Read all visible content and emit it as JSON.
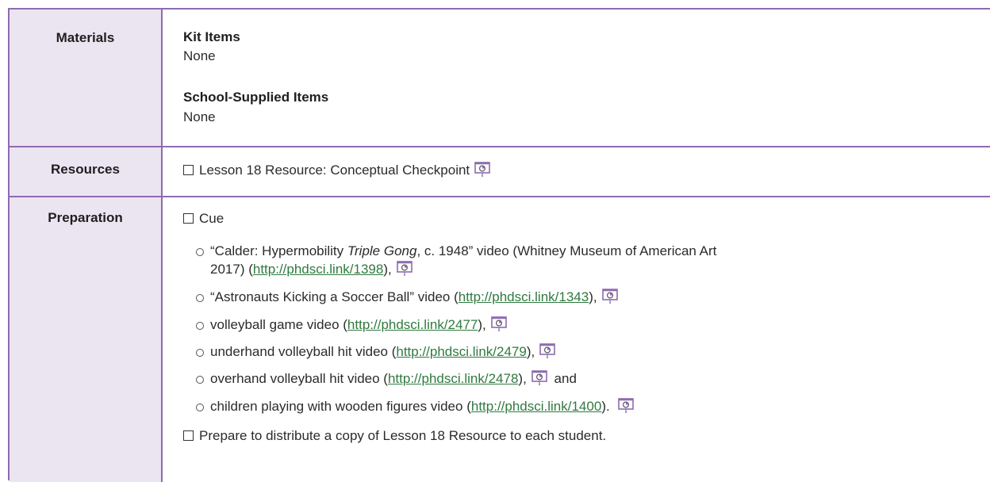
{
  "materials": {
    "label": "Materials",
    "kit_heading": "Kit Items",
    "kit_value": "None",
    "school_heading": "School-Supplied Items",
    "school_value": "None"
  },
  "resources": {
    "label": "Resources",
    "item": "Lesson 18 Resource: Conceptual Checkpoint"
  },
  "preparation": {
    "label": "Preparation",
    "cue": "Cue",
    "videos": [
      {
        "pre": "“Calder: Hypermobility ",
        "italic": "Triple Gong",
        "post": ", c. 1948” video (Whitney Museum of American Art",
        "line2_pre": "2017) (",
        "link": "http://phdsci.link/1398",
        "after": "),"
      },
      {
        "pre": "“Astronauts Kicking a Soccer Ball” video (",
        "link": "http://phdsci.link/1343",
        "after": "),"
      },
      {
        "pre": "volleyball game video (",
        "link": "http://phdsci.link/2477",
        "after": "),"
      },
      {
        "pre": "underhand volleyball hit video (",
        "link": "http://phdsci.link/2479",
        "after": "),"
      },
      {
        "pre": "overhand volleyball hit video (",
        "link": "http://phdsci.link/2478",
        "after": "),",
        "tail": "and"
      },
      {
        "pre": "children playing with wooden figures video (",
        "link": "http://phdsci.link/1400",
        "after": ")."
      }
    ],
    "distribute": "Prepare to distribute a copy of Lesson 18 Resource to each student."
  },
  "icons": {
    "presentation": "presentation-icon",
    "checkbox": "checkbox-icon",
    "bullet": "bullet-icon"
  },
  "colors": {
    "border": "#8e6bb0",
    "label_bg": "#ebe4f1",
    "link": "#2f7a3f"
  }
}
